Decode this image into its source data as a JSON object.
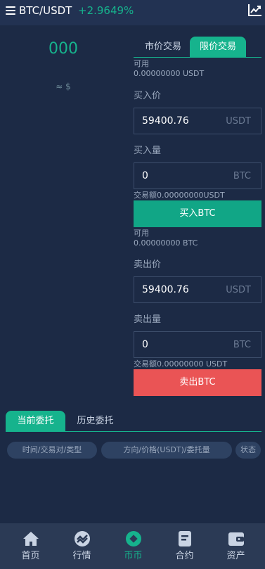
{
  "header": {
    "pair": "BTC/USDT",
    "change": "+2.9649%"
  },
  "price": {
    "value": "000",
    "usd": "≈ $"
  },
  "trade_tabs": {
    "market": "市价交易",
    "limit": "限价交易"
  },
  "buy": {
    "available_label": "可用",
    "available_value": "0.00000000 USDT",
    "price_label": "买入价",
    "price_value": "59400.76",
    "price_unit": "USDT",
    "amount_label": "买入量",
    "amount_value": "0",
    "amount_unit": "BTC",
    "turnover": "交易额0.00000000USDT",
    "button": "买入BTC"
  },
  "sell": {
    "available_label": "可用",
    "available_value": "0.00000000 BTC",
    "price_label": "卖出价",
    "price_value": "59400.76",
    "price_unit": "USDT",
    "amount_label": "卖出量",
    "amount_value": "0",
    "amount_unit": "BTC",
    "turnover": "交易额0.00000000 USDT",
    "button": "卖出BTC"
  },
  "orders": {
    "tab_current": "当前委托",
    "tab_history": "历史委托",
    "columns": [
      "时间/交易对/类型",
      "方向/价格(USDT)/委托量",
      "状态"
    ]
  },
  "nav": [
    {
      "label": "首页",
      "icon": "home-icon"
    },
    {
      "label": "行情",
      "icon": "market-icon"
    },
    {
      "label": "币币",
      "icon": "spot-icon"
    },
    {
      "label": "合约",
      "icon": "contract-icon"
    },
    {
      "label": "资产",
      "icon": "wallet-icon"
    }
  ],
  "colors": {
    "background": "#1c2a45",
    "accent": "#16b38d",
    "buy": "#11a686",
    "sell": "#ea5455"
  }
}
